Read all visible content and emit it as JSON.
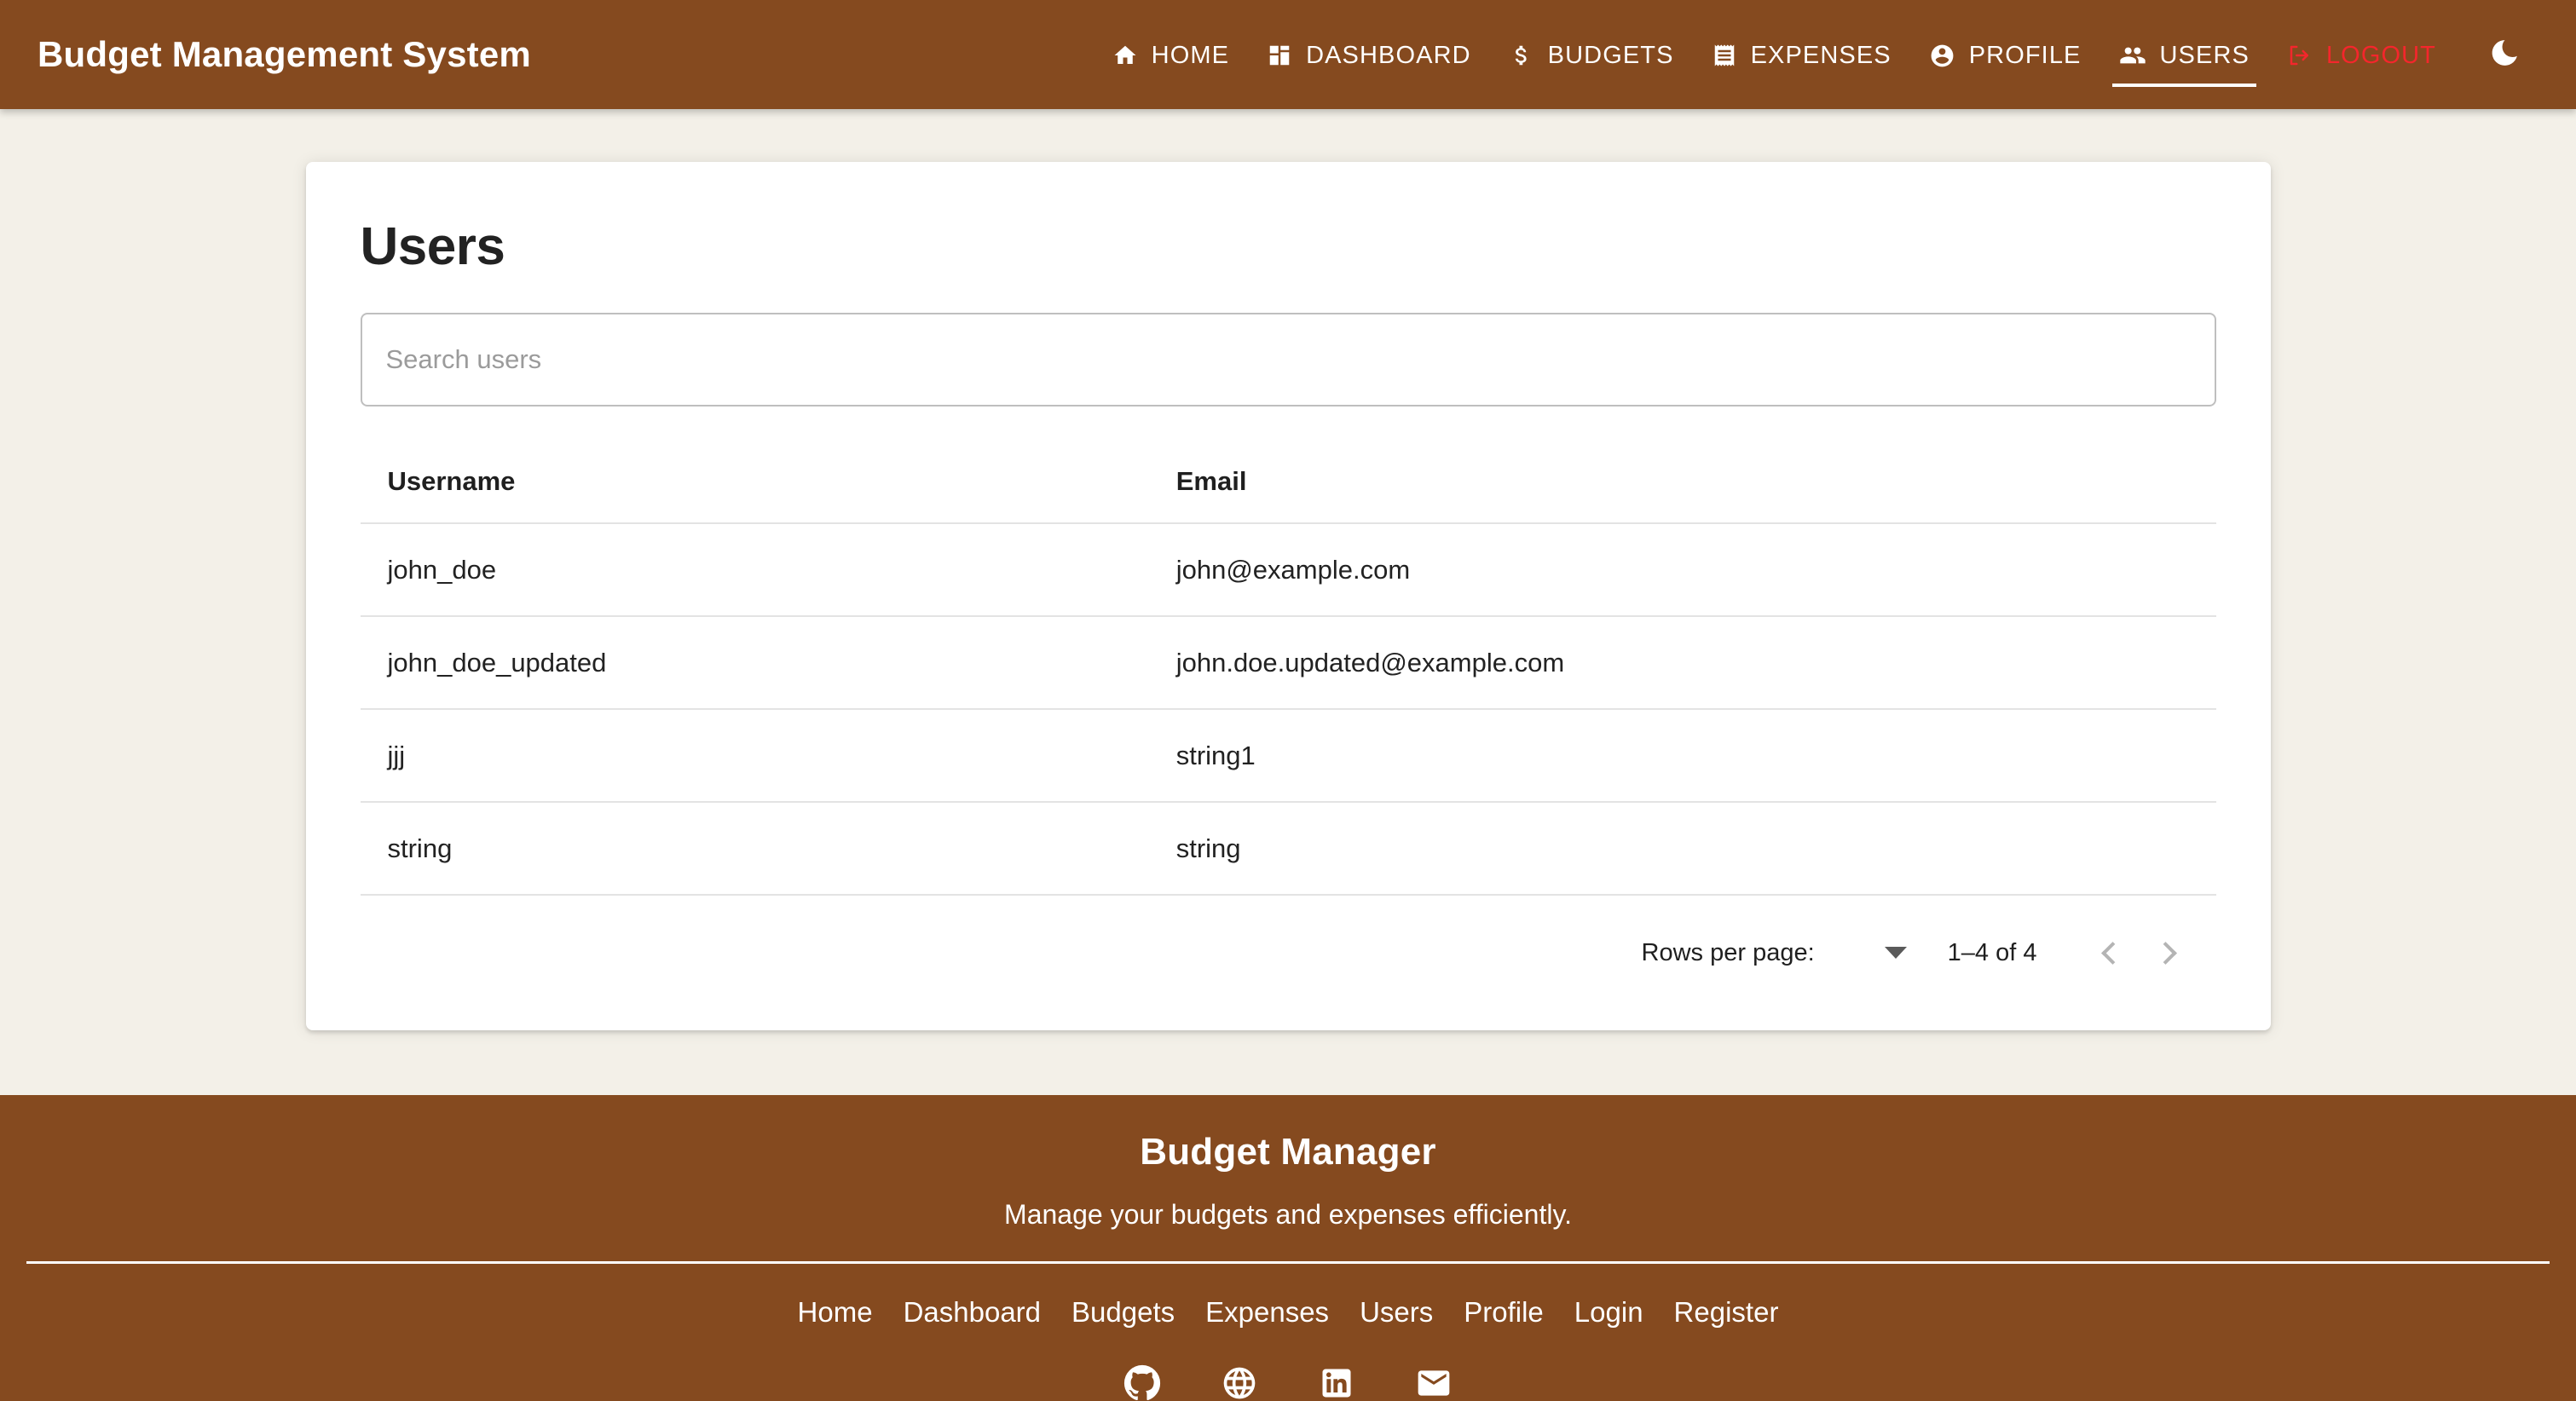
{
  "header": {
    "brand": "Budget Management System",
    "nav": [
      {
        "label": "HOME",
        "icon": "home-icon",
        "active": false
      },
      {
        "label": "DASHBOARD",
        "icon": "dashboard-icon",
        "active": false
      },
      {
        "label": "BUDGETS",
        "icon": "dollar-icon",
        "active": false
      },
      {
        "label": "EXPENSES",
        "icon": "receipt-icon",
        "active": false
      },
      {
        "label": "PROFILE",
        "icon": "account-circle-icon",
        "active": false
      },
      {
        "label": "USERS",
        "icon": "people-icon",
        "active": true
      },
      {
        "label": "LOGOUT",
        "icon": "logout-icon",
        "active": false
      }
    ],
    "theme_toggle_icon": "moon-icon",
    "colors": {
      "bar": "#854A1F",
      "text": "#FFFFFF",
      "logout": "#F4262C"
    }
  },
  "main": {
    "title": "Users",
    "search": {
      "value": "",
      "placeholder": "Search users"
    },
    "table": {
      "columns": [
        "Username",
        "Email"
      ],
      "rows": [
        {
          "username": "john_doe",
          "email": "john@example.com"
        },
        {
          "username": "john_doe_updated",
          "email": "john.doe.updated@example.com"
        },
        {
          "username": "jjj",
          "email": "string1"
        },
        {
          "username": "string",
          "email": "string"
        }
      ]
    },
    "pagination": {
      "rows_per_page_label": "Rows per page:",
      "rows_per_page_value": "",
      "range": "1–4 of 4",
      "prev_icon": "chevron-left-icon",
      "next_icon": "chevron-right-icon"
    }
  },
  "footer": {
    "title": "Budget Manager",
    "subtitle": "Manage your budgets and expenses efficiently.",
    "links": [
      "Home",
      "Dashboard",
      "Budgets",
      "Expenses",
      "Users",
      "Profile",
      "Login",
      "Register"
    ],
    "socials": [
      "github-icon",
      "globe-icon",
      "linkedin-icon",
      "email-icon"
    ]
  },
  "page": {
    "background": "#F3F0E8",
    "card_background": "#FFFFFF"
  }
}
